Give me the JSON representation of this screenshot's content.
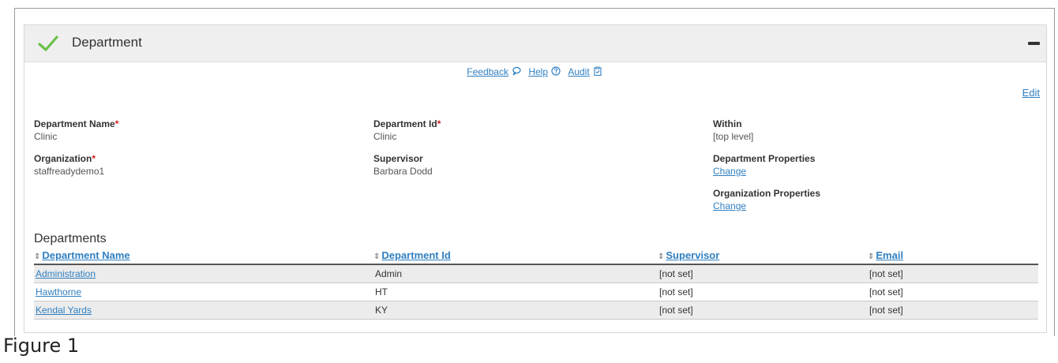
{
  "card": {
    "title": "Department",
    "icons": {
      "status": "check-icon",
      "collapse": "minus-icon"
    }
  },
  "toplinks": {
    "feedback": "Feedback",
    "help": "Help",
    "audit": "Audit"
  },
  "edit_label": "Edit",
  "fields": {
    "department_name": {
      "label": "Department Name",
      "required": "*",
      "value": "Clinic"
    },
    "department_id": {
      "label": "Department Id",
      "required": "*",
      "value": "Clinic"
    },
    "within": {
      "label": "Within",
      "value": "[top level]"
    },
    "organization": {
      "label": "Organization",
      "required": "*",
      "value": "staffreadydemo1"
    },
    "supervisor": {
      "label": "Supervisor",
      "value": "Barbara Dodd"
    },
    "department_properties": {
      "label": "Department Properties",
      "link": "Change"
    },
    "organization_properties": {
      "label": "Organization Properties",
      "link": "Change"
    }
  },
  "departments": {
    "title": "Departments",
    "columns": [
      "Department Name",
      "Department Id",
      "Supervisor",
      "Email"
    ],
    "rows": [
      [
        "Administration",
        "Admin",
        "[not set]",
        "[not set]"
      ],
      [
        "Hawthorne",
        "HT",
        "[not set]",
        "[not set]"
      ],
      [
        "Kendal Yards",
        "KY",
        "[not set]",
        "[not set]"
      ]
    ]
  },
  "caption": "Figure 1",
  "colors": {
    "link": "#2f7fc1",
    "check": "#6cc04a",
    "required": "#d62020",
    "header_bg": "#efefef"
  }
}
